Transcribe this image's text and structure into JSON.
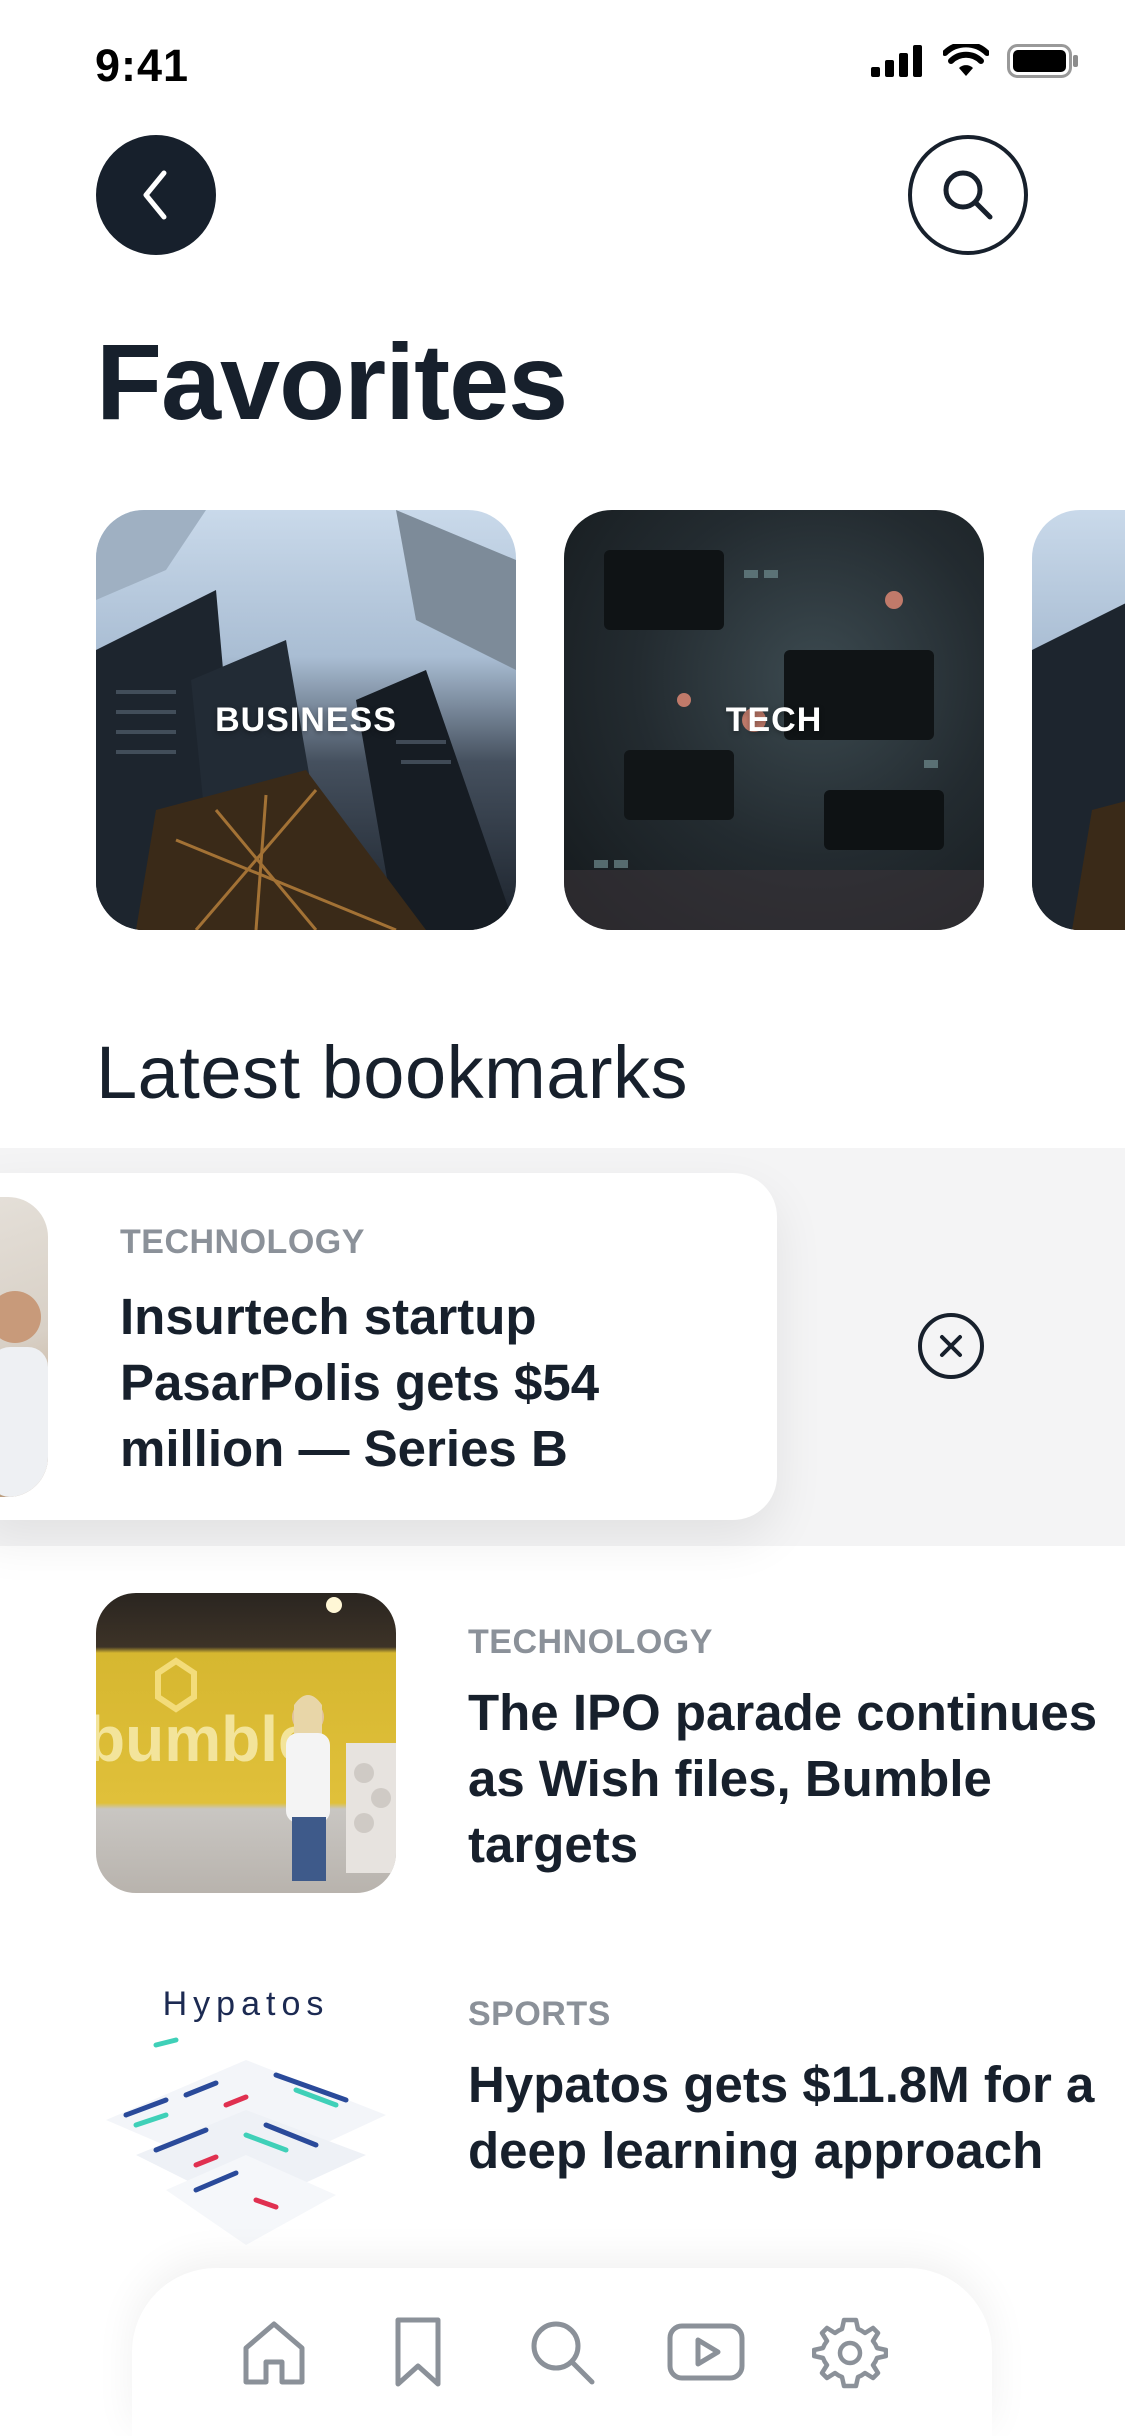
{
  "status_bar": {
    "time": "9:41"
  },
  "header": {
    "title": "Favorites"
  },
  "favorites": [
    {
      "label": "BUSINESS"
    },
    {
      "label": "TECH"
    },
    {
      "label": ""
    }
  ],
  "bookmarks": {
    "section_title": "Latest bookmarks",
    "items": [
      {
        "category": "TECHNOLOGY",
        "headline": "Insurtech startup PasarPolis gets $54 million — Series B"
      },
      {
        "category": "TECHNOLOGY",
        "headline": "The IPO parade continues as Wish files, Bumble targets",
        "thumb_text": "bumble"
      },
      {
        "category": "SPORTS",
        "headline": "Hypatos gets $11.8M for a deep learning approach",
        "thumb_text": "Hypatos"
      }
    ]
  },
  "nav": {
    "items": [
      {
        "icon": "home-icon"
      },
      {
        "icon": "bookmark-icon"
      },
      {
        "icon": "search-icon"
      },
      {
        "icon": "video-icon"
      },
      {
        "icon": "settings-icon"
      }
    ]
  },
  "colors": {
    "primary": "#17202c",
    "muted": "#8b9199",
    "swipe_bg": "#f4f4f5"
  }
}
